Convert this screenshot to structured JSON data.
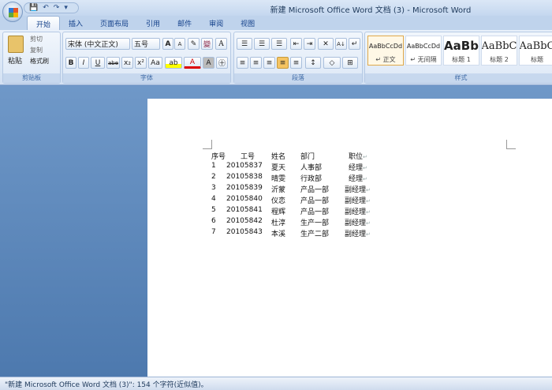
{
  "window": {
    "title": "新建 Microsoft Office Word 文档 (3) - Microsoft Word"
  },
  "qat": {
    "save": "💾",
    "undo": "↶",
    "redo": "↷",
    "more": "▾"
  },
  "tabs": [
    "开始",
    "插入",
    "页面布局",
    "引用",
    "邮件",
    "审阅",
    "视图"
  ],
  "clipboard": {
    "paste": "粘贴",
    "cut": "剪切",
    "copy": "复制",
    "format_painter": "格式刷",
    "label": "剪贴板"
  },
  "font": {
    "name": "宋体 (中文正文)",
    "size": "五号",
    "label": "字体",
    "grow": "A",
    "shrink": "A",
    "clear": "✎",
    "phonetic": "變",
    "border": "A",
    "bold": "B",
    "italic": "I",
    "underline": "U",
    "strike": "abe",
    "sub": "x₂",
    "sup": "x²",
    "case": "Aa",
    "highlight": "ab",
    "color": "A",
    "shade": "A",
    "enclose": "㊉"
  },
  "paragraph": {
    "label": "段落",
    "bullets": "☰",
    "numbering": "☰",
    "multilevel": "☰",
    "dec_indent": "⇤",
    "inc_indent": "⇥",
    "cjk": "✕",
    "sort": "A↓",
    "marks": "↵",
    "left": "≡",
    "center": "≡",
    "right": "≡",
    "justify": "≡",
    "distributed": "≡",
    "spacing": "↕",
    "shading": "◇",
    "borders": "⊞"
  },
  "styles": {
    "label": "样式",
    "items": [
      {
        "sample": "AaBbCcDd",
        "name": "↵ 正文"
      },
      {
        "sample": "AaBbCcDd",
        "name": "↵ 无间隔"
      },
      {
        "sample": "AaBb",
        "name": "标题 1"
      },
      {
        "sample": "AaBbC",
        "name": "标题 2"
      },
      {
        "sample": "AaBbC",
        "name": "标题"
      }
    ]
  },
  "document": {
    "headers": [
      "序号",
      "工号",
      "姓名",
      "部门",
      "职位"
    ],
    "rows": [
      [
        "1",
        "20105837",
        "夏天",
        "人事部",
        "经理"
      ],
      [
        "2",
        "20105838",
        "晴雯",
        "行政部",
        "经理"
      ],
      [
        "3",
        "20105839",
        "沂蒙",
        "产品一部",
        "副经理"
      ],
      [
        "4",
        "20105840",
        "仪恋",
        "产品一部",
        "副经理"
      ],
      [
        "5",
        "20105841",
        "程辉",
        "产品一部",
        "副经理"
      ],
      [
        "6",
        "20105842",
        "杜淳",
        "生产一部",
        "副经理"
      ],
      [
        "7",
        "20105843",
        "本溪",
        "生产二部",
        "副经理"
      ]
    ],
    "para_mark": "↵"
  },
  "status": {
    "text": "\"新建 Microsoft Office Word 文档 (3)\": 154 个字符(近似值)。"
  }
}
